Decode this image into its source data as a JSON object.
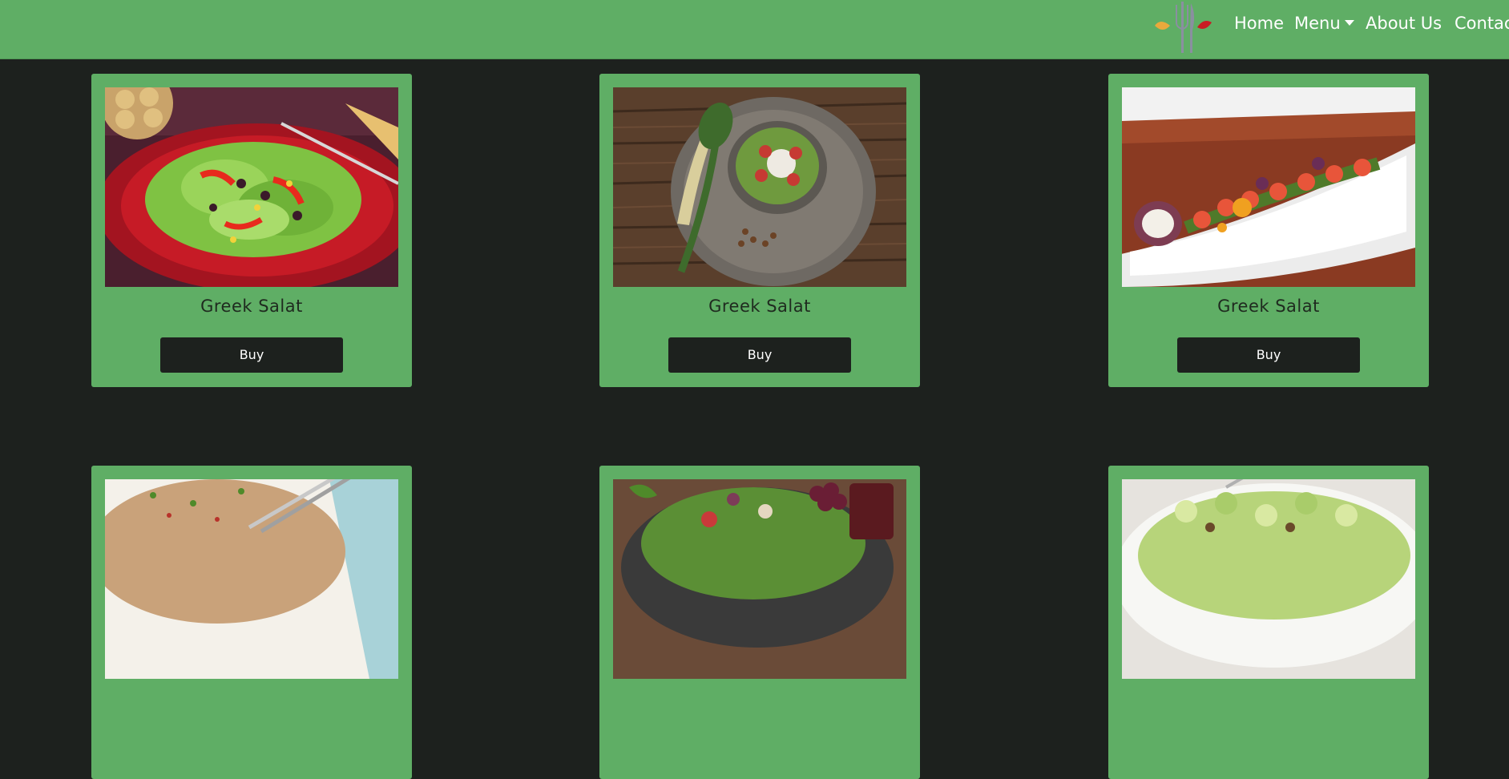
{
  "nav": {
    "logo_icon": "salad-fork-knife-logo-icon",
    "links": [
      {
        "label": "Home"
      },
      {
        "label": "Menu"
      },
      {
        "label": "About Us"
      },
      {
        "label": "Contac"
      }
    ],
    "menu_caret_icon": "caret-down-icon"
  },
  "products": [
    {
      "name": "Greek Salat",
      "button": "Buy",
      "image": "green-salad-on-red-plate"
    },
    {
      "name": "Greek Salat",
      "button": "Buy",
      "image": "salad-bowl-on-wooden-table"
    },
    {
      "name": "Greek Salat",
      "button": "Buy",
      "image": "shrimp-salad-on-white-platter"
    },
    {
      "image": "quinoa-salad"
    },
    {
      "image": "leafy-salad-with-grapes"
    },
    {
      "image": "cucumber-salad-bowl"
    }
  ],
  "colors": {
    "background": "#1d211e",
    "brand_green": "#5fae65",
    "button": "#1d211e",
    "title_text": "#1f2a1f"
  }
}
